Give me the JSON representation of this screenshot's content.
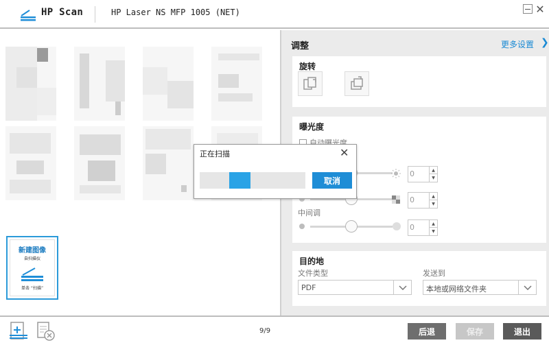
{
  "titlebar": {
    "app_name": "HP Scan",
    "device_name": "HP Laser NS MFP 1005 (NET)",
    "minimize_label": "",
    "close_symbol": "✕"
  },
  "thumbnails": {
    "count": 8,
    "new_image": {
      "title": "新建图像",
      "subtitle": "自扫描仪",
      "hint": "单击 “扫描”"
    }
  },
  "adjust": {
    "title": "调整",
    "more_settings": "更多设置",
    "more_arrow": "❯",
    "rotate": {
      "title": "旋转"
    },
    "exposure": {
      "title": "曝光度",
      "auto_label": "自动曝光度",
      "auto_checked": false,
      "brightness": {
        "value": "0",
        "level": 0.5
      },
      "contrast": {
        "value": "0",
        "level": 0.5
      },
      "midtones": {
        "label": "中间调",
        "value": "0",
        "level": 0.5
      }
    },
    "destination": {
      "title": "目的地",
      "file_type_label": "文件类型",
      "file_type_value": "PDF",
      "send_to_label": "发送到",
      "send_to_value": "本地或网络文件夹"
    }
  },
  "dialog": {
    "title": "正在扫描",
    "close_symbol": "✕",
    "cancel_label": "取消",
    "progress_segment": {
      "start": 0.28,
      "end": 0.48
    }
  },
  "bottombar": {
    "page_count": "9/9",
    "back_label": "后退",
    "save_label": "保存",
    "exit_label": "退出"
  },
  "colors": {
    "accent": "#1e8dd6",
    "progress": "#2aa3e6",
    "panel_bg": "#ebebeb"
  }
}
